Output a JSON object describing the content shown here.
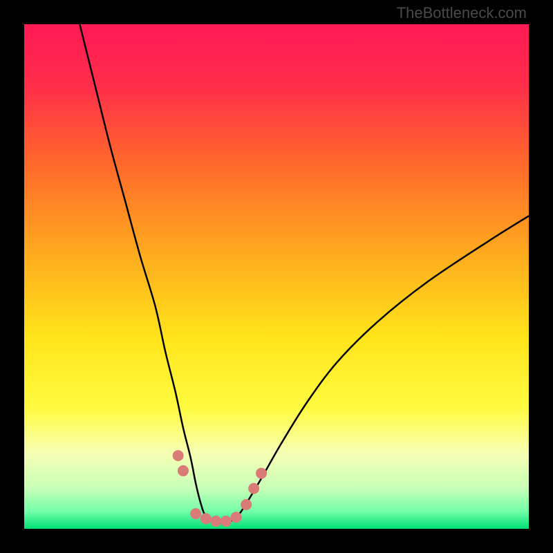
{
  "watermark": "TheBottleneck.com",
  "chart_data": {
    "type": "line",
    "title": "",
    "xlabel": "",
    "ylabel": "",
    "xlim": [
      0,
      100
    ],
    "ylim": [
      0,
      100
    ],
    "gradient_stops": [
      {
        "offset": 0.0,
        "color": "#ff1a55"
      },
      {
        "offset": 0.12,
        "color": "#ff2d4a"
      },
      {
        "offset": 0.28,
        "color": "#ff6a2a"
      },
      {
        "offset": 0.45,
        "color": "#ffa91e"
      },
      {
        "offset": 0.62,
        "color": "#ffe41a"
      },
      {
        "offset": 0.76,
        "color": "#fffb40"
      },
      {
        "offset": 0.85,
        "color": "#f6ffb4"
      },
      {
        "offset": 0.92,
        "color": "#c8ffb8"
      },
      {
        "offset": 0.965,
        "color": "#74ffa8"
      },
      {
        "offset": 1.0,
        "color": "#00e076"
      }
    ],
    "series": [
      {
        "name": "bottleneck-curve",
        "color": "#000000",
        "x": [
          11,
          14,
          17,
          20,
          23,
          26,
          28,
          30,
          31.5,
          33,
          34,
          35,
          36,
          38,
          40,
          42,
          44,
          47,
          51,
          56,
          62,
          70,
          80,
          92,
          100
        ],
        "y": [
          100,
          88,
          76,
          65,
          54,
          44,
          35,
          27,
          20,
          14,
          9,
          5,
          2.5,
          1.3,
          1.3,
          2.2,
          5,
          10,
          17,
          25,
          33,
          41,
          49,
          57,
          62
        ]
      }
    ],
    "markers": {
      "name": "highlight-dots",
      "color": "#d97b77",
      "radius": 8,
      "points": [
        {
          "x": 30.5,
          "y": 14.5
        },
        {
          "x": 31.5,
          "y": 11.5
        },
        {
          "x": 34.0,
          "y": 3.0
        },
        {
          "x": 36.0,
          "y": 2.0
        },
        {
          "x": 38.0,
          "y": 1.5
        },
        {
          "x": 40.0,
          "y": 1.5
        },
        {
          "x": 42.0,
          "y": 2.3
        },
        {
          "x": 44.0,
          "y": 4.8
        },
        {
          "x": 45.5,
          "y": 8.0
        },
        {
          "x": 47.0,
          "y": 11.0
        }
      ]
    }
  }
}
